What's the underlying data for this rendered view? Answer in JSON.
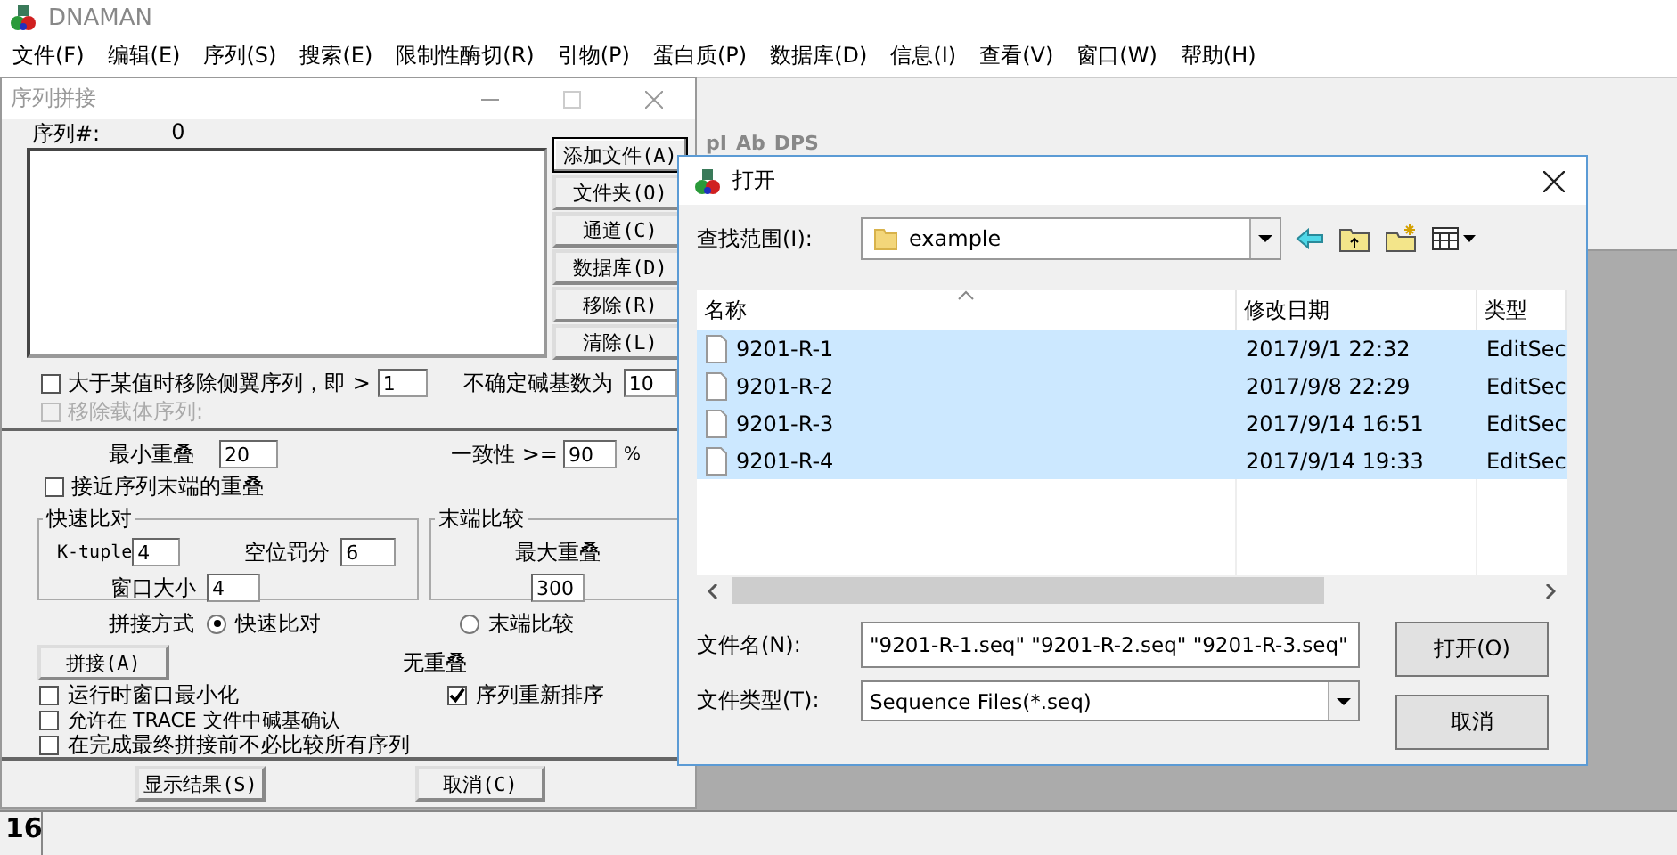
{
  "app": {
    "title": "DNAMAN",
    "menu": [
      "文件(F)",
      "编辑(E)",
      "序列(S)",
      "搜索(E)",
      "限制性酶切(R)",
      "引物(P)",
      "蛋白质(P)",
      "数据库(D)",
      "信息(I)",
      "查看(V)",
      "窗口(W)",
      "帮助(H)"
    ]
  },
  "toolbar": {
    "buttons": [
      "pI",
      "Ab",
      "DPS"
    ]
  },
  "status_bar": {
    "text": "16"
  },
  "assembly_dialog": {
    "title": "序列拼接",
    "count_label": "序列#:",
    "count": "0",
    "buttons": [
      {
        "label": "添加文件(A)",
        "default": true
      },
      {
        "label": "文件夹(O)",
        "default": false
      },
      {
        "label": "通道(C)",
        "default": false
      },
      {
        "label": "数据库(D)",
        "default": false
      },
      {
        "label": "移除(R)",
        "default": false
      },
      {
        "label": "清除(L)",
        "default": false
      }
    ],
    "trim_flank": {
      "label": "大于某值时移除侧翼序列，即 >",
      "checked": false,
      "value": "1"
    },
    "ambiguous": {
      "label": "不确定碱基数为",
      "value": "10"
    },
    "remove_vector": {
      "label": "移除载体序列:",
      "checked": false,
      "disabled": true
    },
    "min_overlap": {
      "label": "最小重叠",
      "value": "20"
    },
    "identity": {
      "label": "一致性 >=",
      "value": "90",
      "unit": "%"
    },
    "end_overlap": {
      "label": "接近序列末端的重叠",
      "checked": false
    },
    "fast_align": {
      "title": "快速比对",
      "ktuple": {
        "label": "K-tuple",
        "value": "4"
      },
      "gap_penalty": {
        "label": "空位罚分",
        "value": "6"
      },
      "window_size": {
        "label": "窗口大小",
        "value": "4"
      }
    },
    "end_compare": {
      "title": "末端比较",
      "max_overlap": {
        "label": "最大重叠",
        "value": "300"
      }
    },
    "method": {
      "label": "拼接方式",
      "options": [
        {
          "label": "快速比对",
          "selected": true
        },
        {
          "label": "末端比较",
          "selected": false
        }
      ]
    },
    "assemble_button": "拼接(A)",
    "no_overlap": "无重叠",
    "reorder": {
      "label": "序列重新排序",
      "checked": true
    },
    "options": [
      {
        "label": "运行时窗口最小化",
        "checked": false
      },
      {
        "label": "允许在 TRACE 文件中碱基确认",
        "checked": false
      },
      {
        "label": "在完成最终拼接前不必比较所有序列",
        "checked": false
      }
    ],
    "footer_buttons": [
      "显示结果(S)",
      "取消(C)"
    ]
  },
  "open_dialog": {
    "title": "打开",
    "look_in": {
      "label": "查找范围(I):",
      "value": "example"
    },
    "columns": [
      "名称",
      "修改日期",
      "类型"
    ],
    "files": [
      {
        "name": "9201-R-1",
        "modified": "2017/9/1 22:32",
        "type": "EditSec",
        "selected": true
      },
      {
        "name": "9201-R-2",
        "modified": "2017/9/8 22:29",
        "type": "EditSec",
        "selected": true
      },
      {
        "name": "9201-R-3",
        "modified": "2017/9/14 16:51",
        "type": "EditSec",
        "selected": true
      },
      {
        "name": "9201-R-4",
        "modified": "2017/9/14 19:33",
        "type": "EditSec",
        "selected": true
      }
    ],
    "file_name": {
      "label": "文件名(N):",
      "value": "\"9201-R-1.seq\" \"9201-R-2.seq\" \"9201-R-3.seq\""
    },
    "file_type": {
      "label": "文件类型(T):",
      "value": "Sequence Files(*.seq)"
    },
    "buttons": [
      "打开(O)",
      "取消"
    ]
  }
}
